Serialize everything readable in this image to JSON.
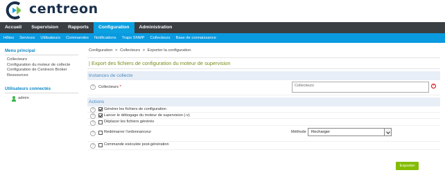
{
  "brand": {
    "name": "centreon"
  },
  "topnav": [
    {
      "label": "Accueil"
    },
    {
      "label": "Supervision"
    },
    {
      "label": "Rapports"
    },
    {
      "label": "Configuration",
      "active": true
    },
    {
      "label": "Administration"
    }
  ],
  "subnav": [
    {
      "label": "Hôtes"
    },
    {
      "label": "Services"
    },
    {
      "label": "Utilisateurs"
    },
    {
      "label": "Commandes"
    },
    {
      "label": "Notifications"
    },
    {
      "label": "Traps SNMP"
    },
    {
      "label": "Collecteurs"
    },
    {
      "label": "Base de connaissance"
    }
  ],
  "sidebar": {
    "menu_title": "Menu principal",
    "items": [
      {
        "label": "Collecteurs"
      },
      {
        "label": "Configuration du moteur de collecte"
      },
      {
        "label": "Configuration de Centreon Broker"
      },
      {
        "label": "Ressources"
      }
    ],
    "users_title": "Utilisateurs connectés",
    "user": "admin"
  },
  "breadcrumb": [
    "Configuration",
    ">",
    "Collecteurs",
    ">",
    "Exporter la configuration"
  ],
  "page_title": "| Export des fichiers de configuration du moteur de supervision",
  "section_instances": "Instances de collecte",
  "collecteurs_label": "Collecteurs",
  "collecteurs_required": "*",
  "collecteurs_placeholder": "Collecteurs",
  "section_actions": "Actions",
  "actions": [
    {
      "label": "Générer les fichiers de configuration",
      "checked": true
    },
    {
      "label": "Lancer le débogage du moteur de supervision (-v)",
      "checked": true
    },
    {
      "label": "Déplacer les fichiers générés",
      "checked": false
    },
    {
      "label": "Redémarrer l'ordonnanceur",
      "checked": false
    },
    {
      "label": "Commande exécutée post-génération",
      "checked": false
    }
  ],
  "method_label": "Méthode",
  "method_value": "Recharger",
  "export_label": "Exporter",
  "help_glyph": "?",
  "clear_glyph": "×",
  "colors": {
    "accent": "#0ba0e0",
    "topnav": "#3a3f44",
    "button": "#84bd00",
    "title": "#7a8a1a"
  }
}
